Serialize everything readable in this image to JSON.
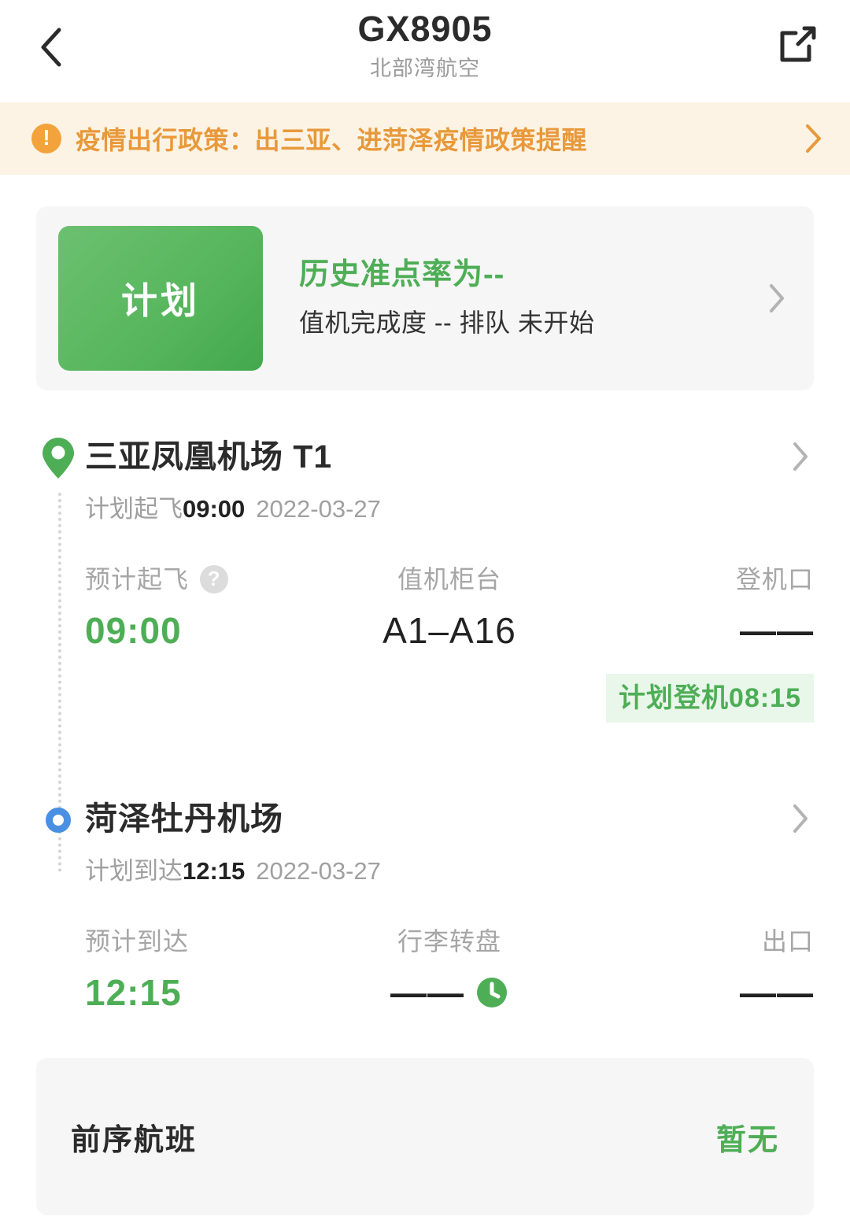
{
  "header": {
    "flight_no": "GX8905",
    "airline": "北部湾航空",
    "back_icon": "chevron-left-icon",
    "share_icon": "share-external-icon"
  },
  "notice": {
    "icon": "warning-exclamation-icon",
    "text": "疫情出行政策：出三亚、进菏泽疫情政策提醒",
    "arrow_icon": "chevron-right-icon",
    "bg_color": "#fdf3e4",
    "text_color": "#e8993b",
    "icon_color": "#f2a33c"
  },
  "status_card": {
    "badge_label": "计划",
    "badge_color": "#58b75e",
    "ontime_rate": "历史准点率为--",
    "ontime_color": "#4eae56",
    "checkin_progress": "值机完成度 -- 排队 未开始",
    "arrow_icon": "chevron-right-icon"
  },
  "route": {
    "departure": {
      "marker_icon": "map-pin-icon",
      "marker_color": "#4eae56",
      "airport": "三亚凤凰机场 T1",
      "arrow_icon": "chevron-right-icon",
      "scheduled_label": "计划起飞",
      "scheduled_time": "09:00",
      "scheduled_date": "2022-03-27",
      "columns": [
        {
          "label": "预计起飞",
          "help_icon": "help-question-icon",
          "value": "09:00",
          "value_style": "green"
        },
        {
          "label": "值机柜台",
          "value": "A1–A16",
          "value_style": "dark"
        },
        {
          "label": "登机口",
          "value": "——",
          "value_style": "dash"
        }
      ],
      "boarding_badge": "计划登机08:15",
      "boarding_badge_bg": "#e9f6ea",
      "boarding_badge_color": "#4eae56"
    },
    "arrival": {
      "marker_icon": "circle-ring-icon",
      "marker_color": "#4a90e2",
      "airport": "菏泽牡丹机场",
      "arrow_icon": "chevron-right-icon",
      "scheduled_label": "计划到达",
      "scheduled_time": "12:15",
      "scheduled_date": "2022-03-27",
      "columns": [
        {
          "label": "预计到达",
          "value": "12:15",
          "value_style": "green"
        },
        {
          "label": "行李转盘",
          "value": "——",
          "value_style": "dash",
          "trailing_icon": "clock-icon"
        },
        {
          "label": "出口",
          "value": "——",
          "value_style": "dash"
        }
      ]
    }
  },
  "prior_flight": {
    "label": "前序航班",
    "value": "暂无",
    "value_color": "#4eae56",
    "arrow_icon": "none"
  }
}
